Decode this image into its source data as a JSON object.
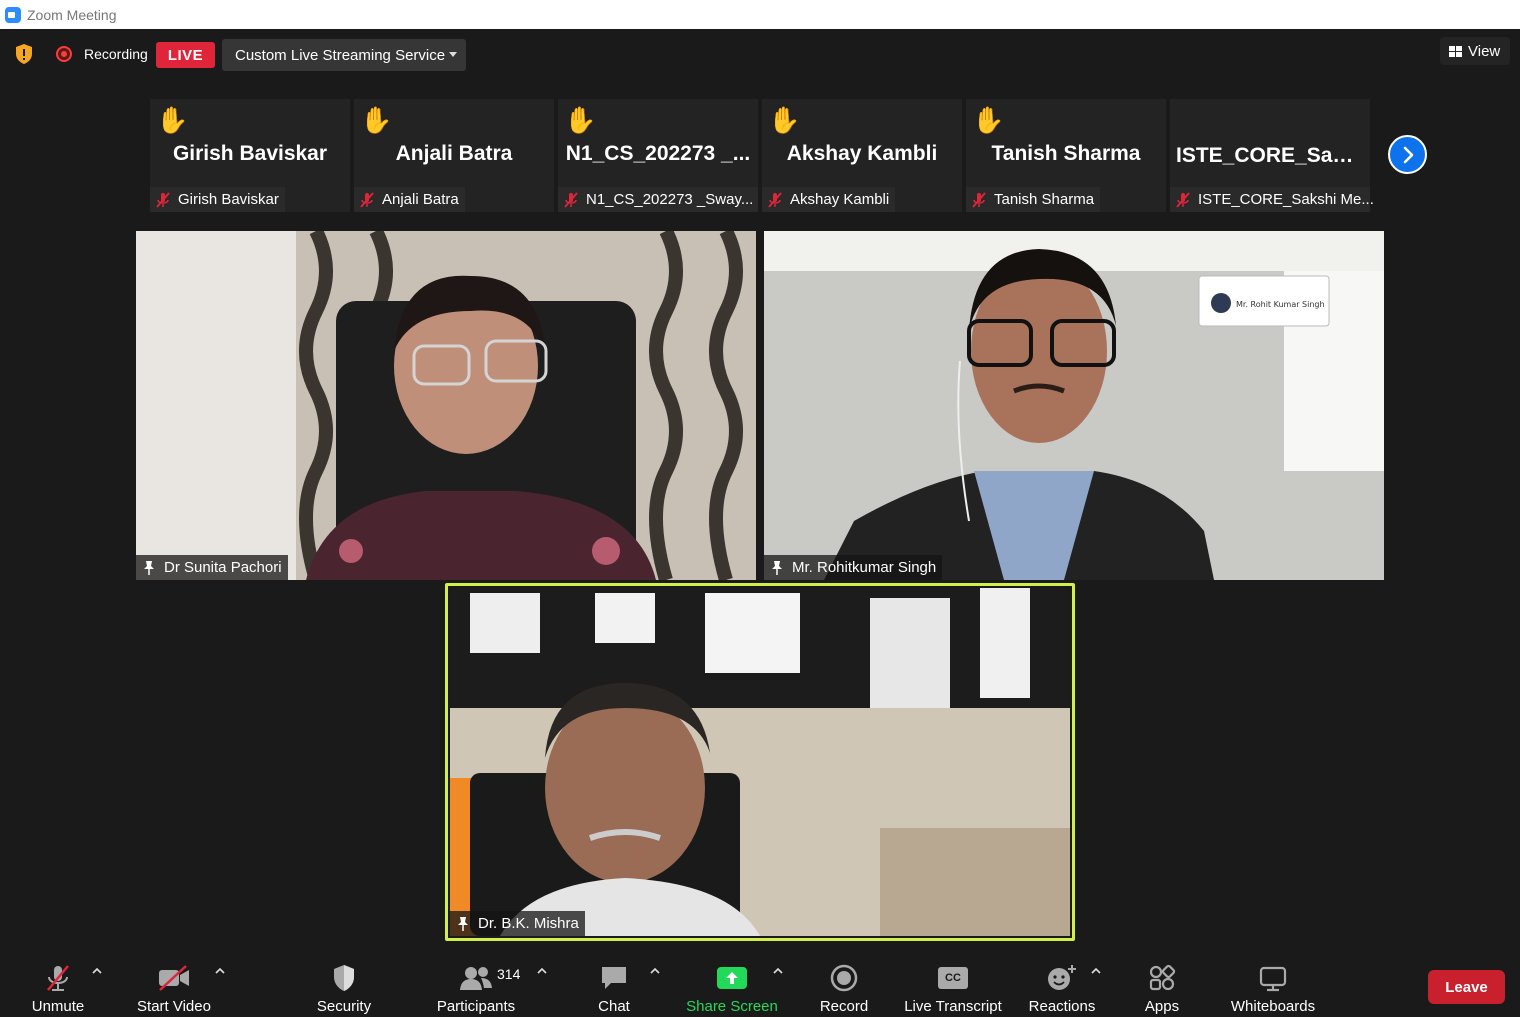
{
  "window": {
    "title": "Zoom Meeting"
  },
  "topbar": {
    "recording_label": "Recording",
    "live_badge": "LIVE",
    "stream_service": "Custom Live Streaming Service",
    "view_label": "View"
  },
  "strip": {
    "tiles": [
      {
        "display": "Girish Baviskar",
        "name": "Girish Baviskar",
        "hand_raised": true
      },
      {
        "display": "Anjali Batra",
        "name": "Anjali Batra",
        "hand_raised": true
      },
      {
        "display": "N1_CS_202273 _...",
        "name": "N1_CS_202273 _Sway...",
        "hand_raised": true
      },
      {
        "display": "Akshay Kambli",
        "name": "Akshay Kambli",
        "hand_raised": true
      },
      {
        "display": "Tanish Sharma",
        "name": "Tanish Sharma",
        "hand_raised": true
      },
      {
        "display": "ISTE_CORE_Saks...",
        "name": "ISTE_CORE_Sakshi Me...",
        "hand_raised": false
      }
    ]
  },
  "videos": {
    "v1": {
      "name": "Dr Sunita Pachori"
    },
    "v2": {
      "name": "Mr. Rohitkumar Singh",
      "nameplate": "Mr. Rohit Kumar Singh"
    },
    "v3": {
      "name": "Dr. B.K. Mishra"
    }
  },
  "toolbar": {
    "unmute": "Unmute",
    "start_video": "Start Video",
    "security": "Security",
    "participants": "Participants",
    "participants_count": "314",
    "chat": "Chat",
    "share_screen": "Share Screen",
    "record": "Record",
    "live_transcript": "Live Transcript",
    "cc": "CC",
    "reactions": "Reactions",
    "apps": "Apps",
    "whiteboards": "Whiteboards",
    "leave": "Leave"
  },
  "colors": {
    "share_green": "#23d959",
    "leave_red": "#c8202d",
    "live_red": "#e0253a",
    "active_speaker_border": "#d1f04c",
    "next_blue": "#0e72ed"
  }
}
